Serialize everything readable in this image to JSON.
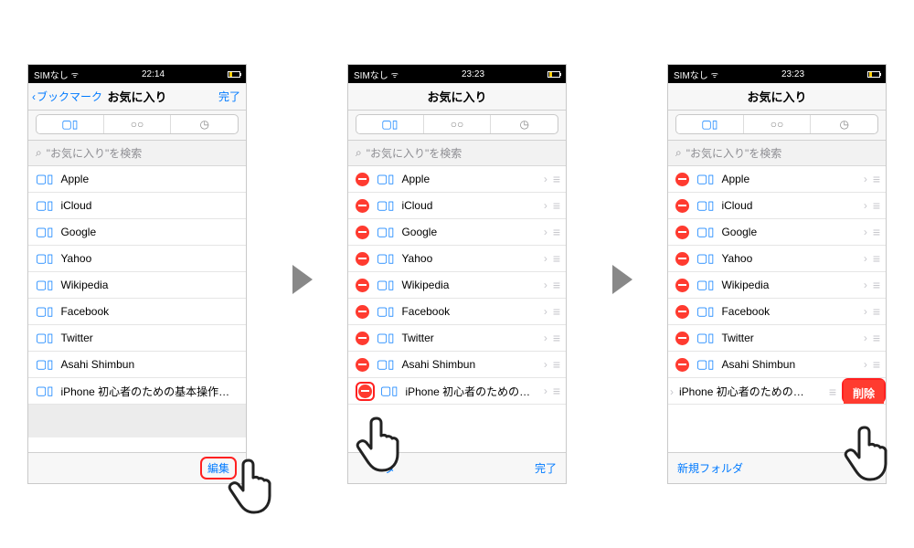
{
  "statusbar": {
    "carrier": "SIMなし",
    "time1": "22:14",
    "time2": "23:23",
    "time3": "23:23"
  },
  "nav": {
    "back": "ブックマーク",
    "title": "お気に入り",
    "done": "完了"
  },
  "search": {
    "placeholder": "\"お気に入り\"を検索"
  },
  "bookmarks": [
    {
      "label": "Apple"
    },
    {
      "label": "iCloud"
    },
    {
      "label": "Google"
    },
    {
      "label": "Yahoo"
    },
    {
      "label": "Wikipedia"
    },
    {
      "label": "Facebook"
    },
    {
      "label": "Twitter"
    },
    {
      "label": "Asahi Shimbun"
    }
  ],
  "long1": "iPhone 初心者のための基本操作方法 | i...",
  "long2": "iPhone 初心者のための…",
  "toolbar": {
    "edit": "編集",
    "newFolder": "新規フォルダ",
    "done": "完了",
    "newFolderPartial": "ダ"
  },
  "delete": "削除"
}
